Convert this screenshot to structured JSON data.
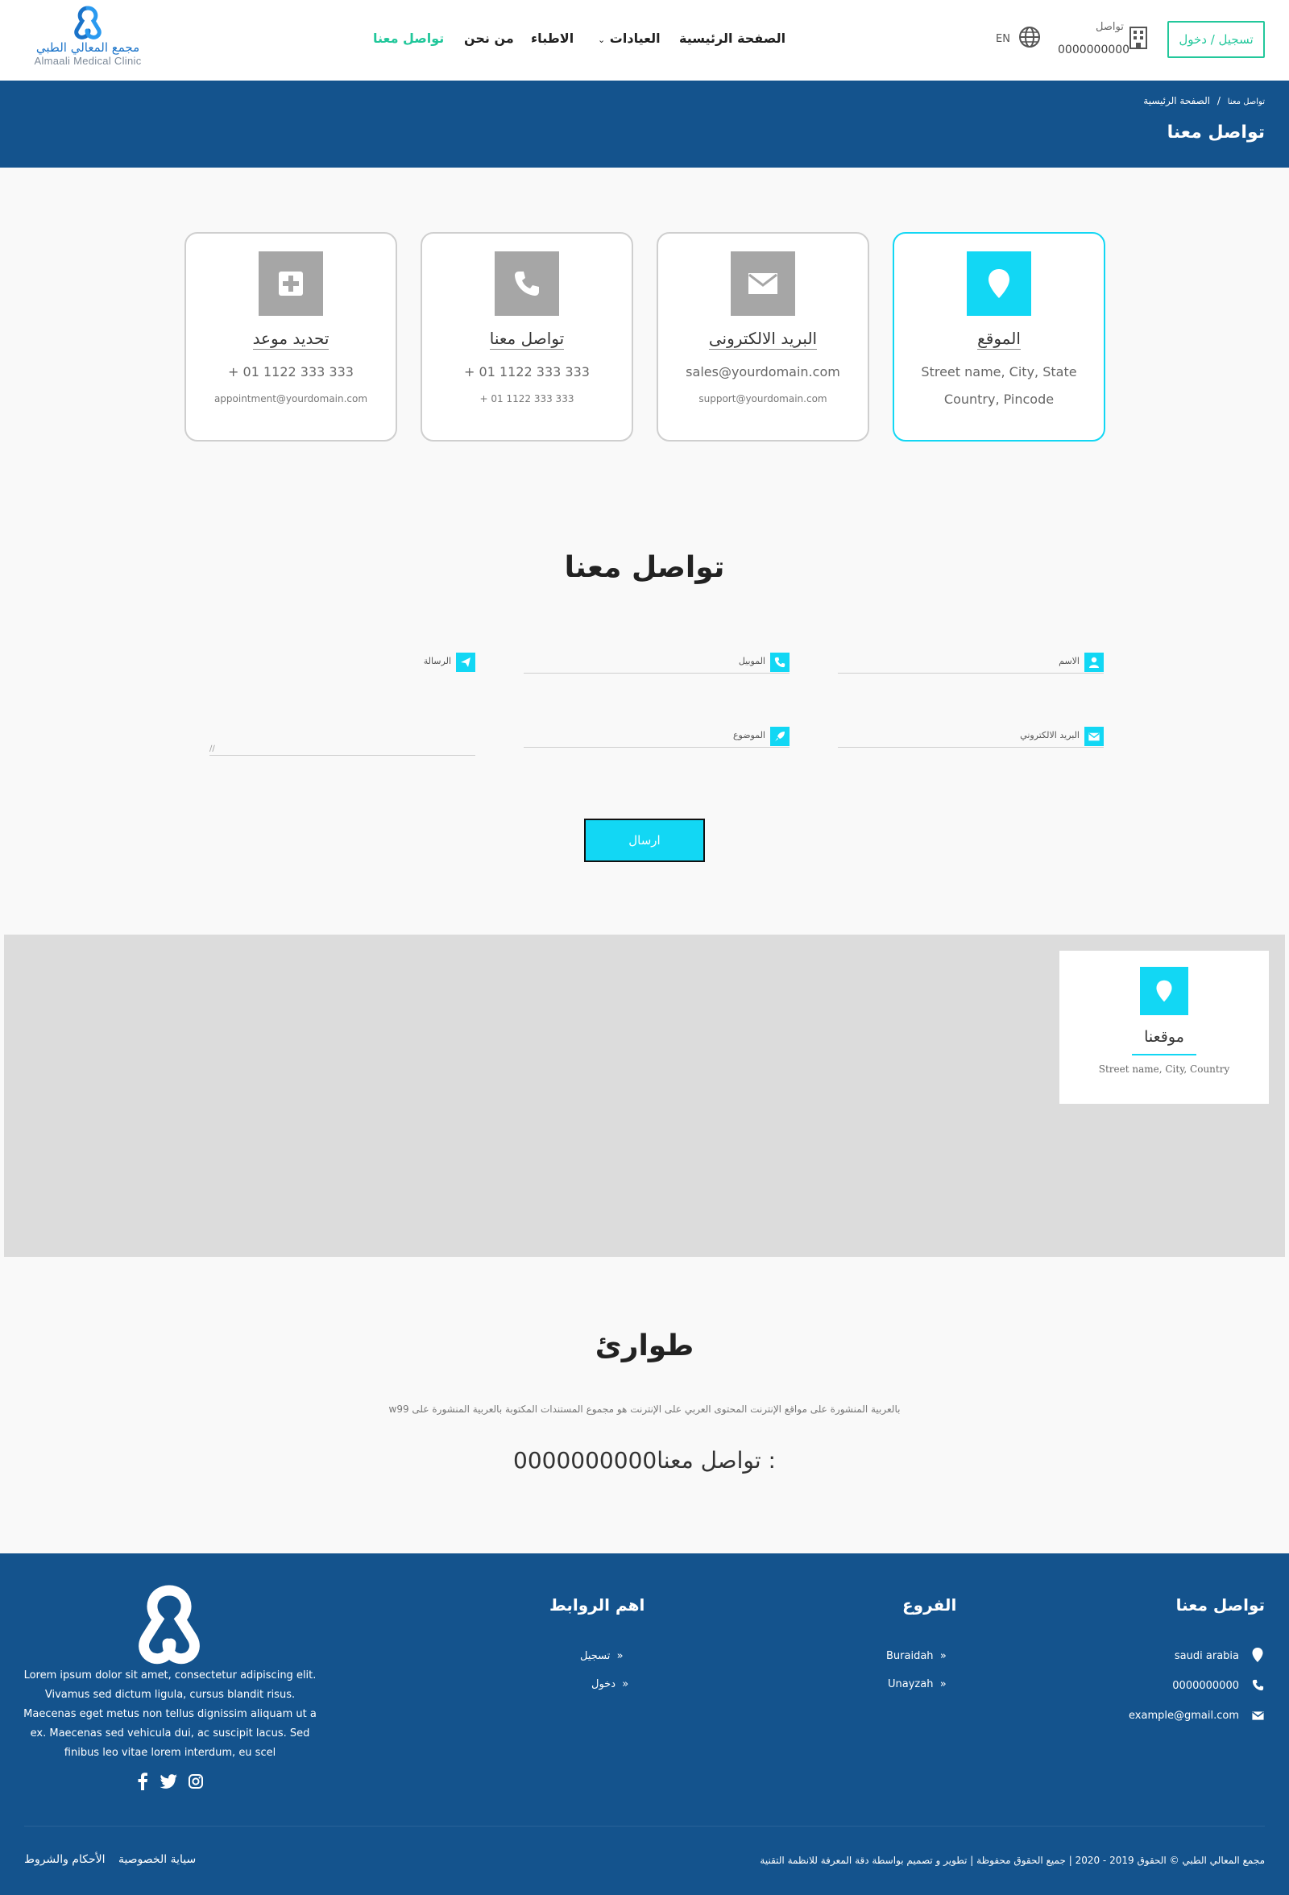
{
  "header": {
    "logo_ar": "مجمع المعالي الطبي",
    "logo_en": "Almaali Medical Clinic",
    "nav": [
      {
        "label": "الصفحة الرئيسية"
      },
      {
        "label": "العيادات"
      },
      {
        "label": "الاطباء"
      },
      {
        "label": "من نحن"
      },
      {
        "label": "تواصل معنا"
      }
    ],
    "login_label": "تسجيل / دخول",
    "contact_label": "تواصل",
    "contact_number": "0000000000",
    "lang_label": "EN",
    "colors": {
      "accent": "#22c79b",
      "primary": "#14538d",
      "cyan": "#12d7f4"
    }
  },
  "banner": {
    "breadcrumb_home": "الصفحة الرئيسية",
    "breadcrumb_sep": "/",
    "breadcrumb_current": "تواصل معنا",
    "title": "تواصل معنا"
  },
  "cards": [
    {
      "icon": "location-pin-icon",
      "title": "الموقع",
      "line1": "Street name, City, State",
      "line2": "Country, Pincode"
    },
    {
      "icon": "envelope-icon",
      "title": "البريد الالكترونى",
      "line1": "sales@yourdomain.com",
      "line2": "support@yourdomain.com"
    },
    {
      "icon": "phone-icon",
      "title": "تواصل معنا",
      "line1": "+ 01 1122 333 333",
      "line2": "+ 01 1122 333 333"
    },
    {
      "icon": "plus-icon",
      "title": "تحديد موعد",
      "line1": "+ 01 1122 333 333",
      "line2": "appointment@yourdomain.com"
    }
  ],
  "form": {
    "title": "تواصل معنا",
    "name_label": "الاسم",
    "mobile_label": "الموبيل",
    "message_label": "الرسالة",
    "email_label": "البريد الالكتروني",
    "subject_label": "الموضوع",
    "send_label": "ارسال"
  },
  "map": {
    "title": "موقعنا",
    "address": "Street name, City, Country"
  },
  "emergency": {
    "title": "طوارئ",
    "text": "بالعربية المنشورة على مواقع الإنترنت المحتوى العربي على الإنترنت هو مجموع المستندات المكتوبة بالعربية المنشورة على w99",
    "phone": "تواصل معنا0000000000 :"
  },
  "footer": {
    "contact_title": "تواصل معنا",
    "contact_items": [
      {
        "icon": "map-marker-icon",
        "text": "saudi arabia"
      },
      {
        "icon": "phone-icon",
        "text": "0000000000"
      },
      {
        "icon": "mail-icon",
        "text": "example@gmail.com"
      }
    ],
    "branches_title": "الفروع",
    "branches": [
      "Buraidah",
      "Unayzah"
    ],
    "links_title": "اهم الروابط",
    "links": [
      "تسجيل",
      "دخول"
    ],
    "description": "Lorem ipsum dolor sit amet, consectetur adipiscing elit. Vivamus sed dictum ligula, cursus blandit risus. Maecenas eget metus non tellus dignissim aliquam ut a ex. Maecenas sed vehicula dui, ac suscipit lacus. Sed finibus leo vitae lorem interdum, eu scel",
    "social": [
      "facebook-icon",
      "twitter-icon",
      "instagram-icon"
    ],
    "copyright": "مجمع المعالي الطبي © الحقوق 2019 - 2020 | جميع الحقوق محفوظة | تطوير و تصميم بواسطة دقة المعرفة للانظمة التقنية",
    "terms_label": "الأحكام والشروط",
    "privacy_label": "سياية الخصوصية"
  }
}
